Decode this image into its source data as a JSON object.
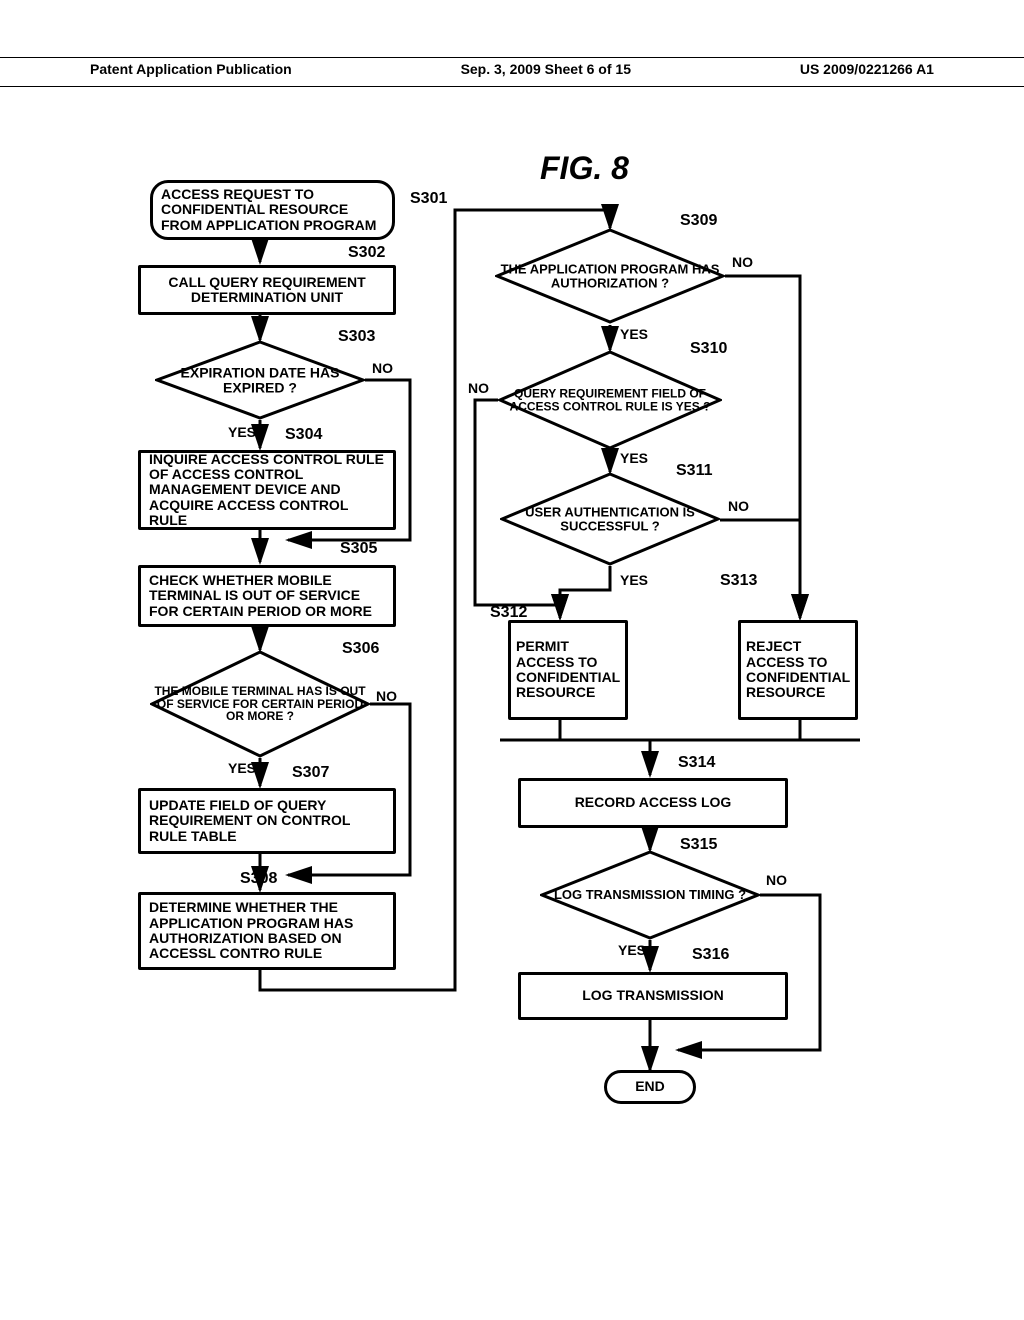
{
  "header": {
    "left": "Patent Application Publication",
    "center": "Sep. 3, 2009  Sheet 6 of 15",
    "right": "US 2009/0221266 A1"
  },
  "figure_label": "FIG. 8",
  "steps": {
    "s301": {
      "label": "S301",
      "text": "ACCESS REQUEST TO CONFIDENTIAL RESOURCE FROM APPLICATION PROGRAM"
    },
    "s302": {
      "label": "S302",
      "text": "CALL  QUERY REQUIREMENT DETERMINATION UNIT"
    },
    "s303": {
      "label": "S303",
      "text": "EXPIRATION DATE HAS EXPIRED ?",
      "yes": "YES",
      "no": "NO"
    },
    "s304": {
      "label": "S304",
      "text": "INQUIRE ACCESS CONTROL RULE OF ACCESS CONTROL MANAGEMENT DEVICE AND ACQUIRE ACCESS CONTROL RULE"
    },
    "s305": {
      "label": "S305",
      "text": "CHECK WHETHER MOBILE TERMINAL IS OUT OF SERVICE FOR CERTAIN PERIOD OR MORE"
    },
    "s306": {
      "label": "S306",
      "text": "THE MOBILE TERMINAL HAS IS OUT OF SERVICE FOR CERTAIN PERIOD OR MORE ?",
      "yes": "YES",
      "no": "NO"
    },
    "s307": {
      "label": "S307",
      "text": "UPDATE FIELD OF QUERY REQUIREMENT ON CONTROL RULE TABLE"
    },
    "s308": {
      "label": "S308",
      "text": "DETERMINE WHETHER THE APPLICATION PROGRAM HAS AUTHORIZATION BASED ON ACCESSL CONTRO RULE"
    },
    "s309": {
      "label": "S309",
      "text": "THE APPLICATION PROGRAM HAS AUTHORIZATION ?",
      "yes": "YES",
      "no": "NO"
    },
    "s310": {
      "label": "S310",
      "text": "QUERY REQUIREMENT FIELD OF ACCESS CONTROL RULE IS YES ?",
      "yes": "YES",
      "no": "NO"
    },
    "s311": {
      "label": "S311",
      "text": "USER AUTHENTICATION IS SUCCESSFUL ?",
      "yes": "YES",
      "no": "NO"
    },
    "s312": {
      "label": "S312",
      "text": "PERMIT ACCESS TO CONFIDENTIAL RESOURCE"
    },
    "s313": {
      "label": "S313",
      "text": "REJECT ACCESS TO CONFIDENTIAL RESOURCE"
    },
    "s314": {
      "label": "S314",
      "text": "RECORD ACCESS LOG"
    },
    "s315": {
      "label": "S315",
      "text": "LOG TRANSMISSION TIMING ?",
      "yes": "YES",
      "no": "NO"
    },
    "s316": {
      "label": "S316",
      "text": "LOG TRANSMISSION"
    },
    "end": {
      "text": "END"
    }
  }
}
